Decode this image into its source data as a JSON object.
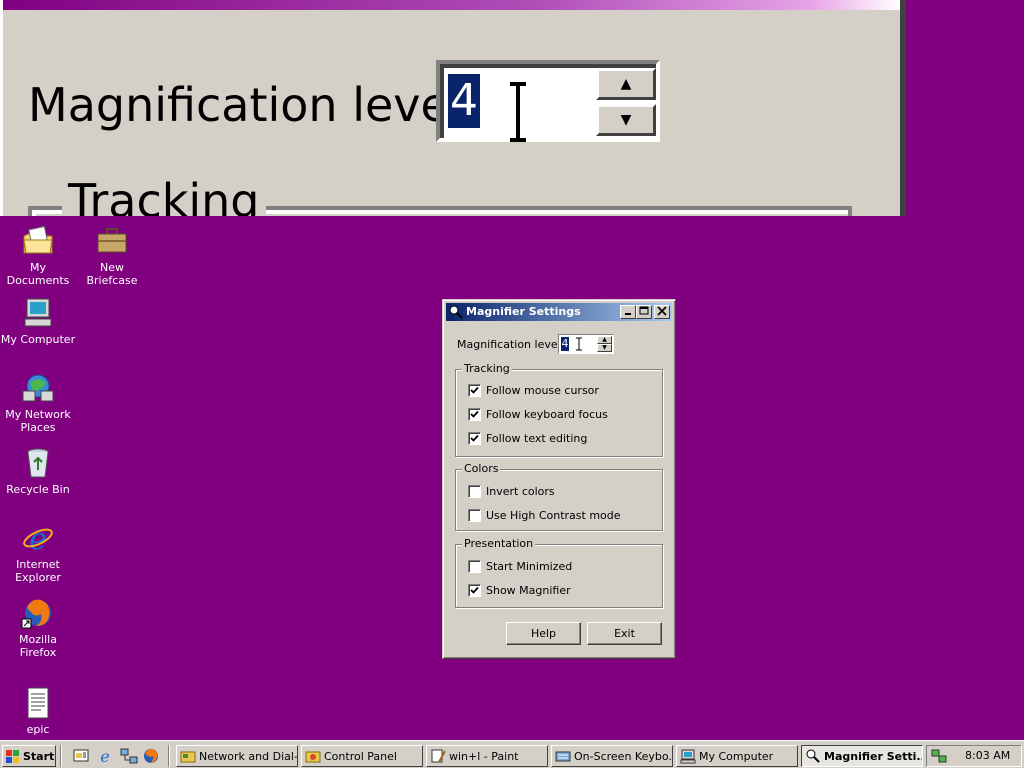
{
  "magnified_view": {
    "label": "Magnification level:",
    "value": "4",
    "group_label": "Tracking"
  },
  "desktop": {
    "icons": [
      {
        "label": "My Documents",
        "icon": "my-documents-icon"
      },
      {
        "label": "New Briefcase",
        "icon": "briefcase-icon"
      },
      {
        "label": "My Computer",
        "icon": "my-computer-icon"
      },
      {
        "label": "My Network Places",
        "icon": "network-places-icon"
      },
      {
        "label": "Recycle Bin",
        "icon": "recycle-bin-icon"
      },
      {
        "label": "Internet Explorer",
        "icon": "internet-explorer-icon"
      },
      {
        "label": "Mozilla Firefox",
        "icon": "firefox-icon"
      },
      {
        "label": "epic",
        "icon": "text-document-icon"
      }
    ],
    "background_color": "#800080"
  },
  "dialog": {
    "title": "Magnifier Settings",
    "magnification_label": "Magnification level:",
    "magnification_value": "4",
    "tracking": {
      "title": "Tracking",
      "options": [
        {
          "label": "Follow mouse cursor",
          "checked": true
        },
        {
          "label": "Follow keyboard focus",
          "checked": true
        },
        {
          "label": "Follow text editing",
          "checked": true
        }
      ]
    },
    "colors": {
      "title": "Colors",
      "options": [
        {
          "label": "Invert colors",
          "checked": false
        },
        {
          "label": "Use High Contrast mode",
          "checked": false
        }
      ]
    },
    "presentation": {
      "title": "Presentation",
      "options": [
        {
          "label": "Start Minimized",
          "checked": false
        },
        {
          "label": "Show Magnifier",
          "checked": true
        }
      ]
    },
    "buttons": {
      "help": "Help",
      "exit": "Exit"
    }
  },
  "taskbar": {
    "start_label": "Start",
    "quick_launch": [
      "show-desktop-icon",
      "internet-explorer-icon",
      "network-icon",
      "firefox-icon"
    ],
    "tasks": [
      {
        "label": "Network and Dial-...",
        "active": false
      },
      {
        "label": "Control Panel",
        "active": false
      },
      {
        "label": "win+l - Paint",
        "active": false
      },
      {
        "label": "On-Screen Keybo...",
        "active": false
      },
      {
        "label": "My Computer",
        "active": false
      },
      {
        "label": "Magnifier Setti...",
        "active": true
      }
    ],
    "clock": "8:03 AM"
  }
}
